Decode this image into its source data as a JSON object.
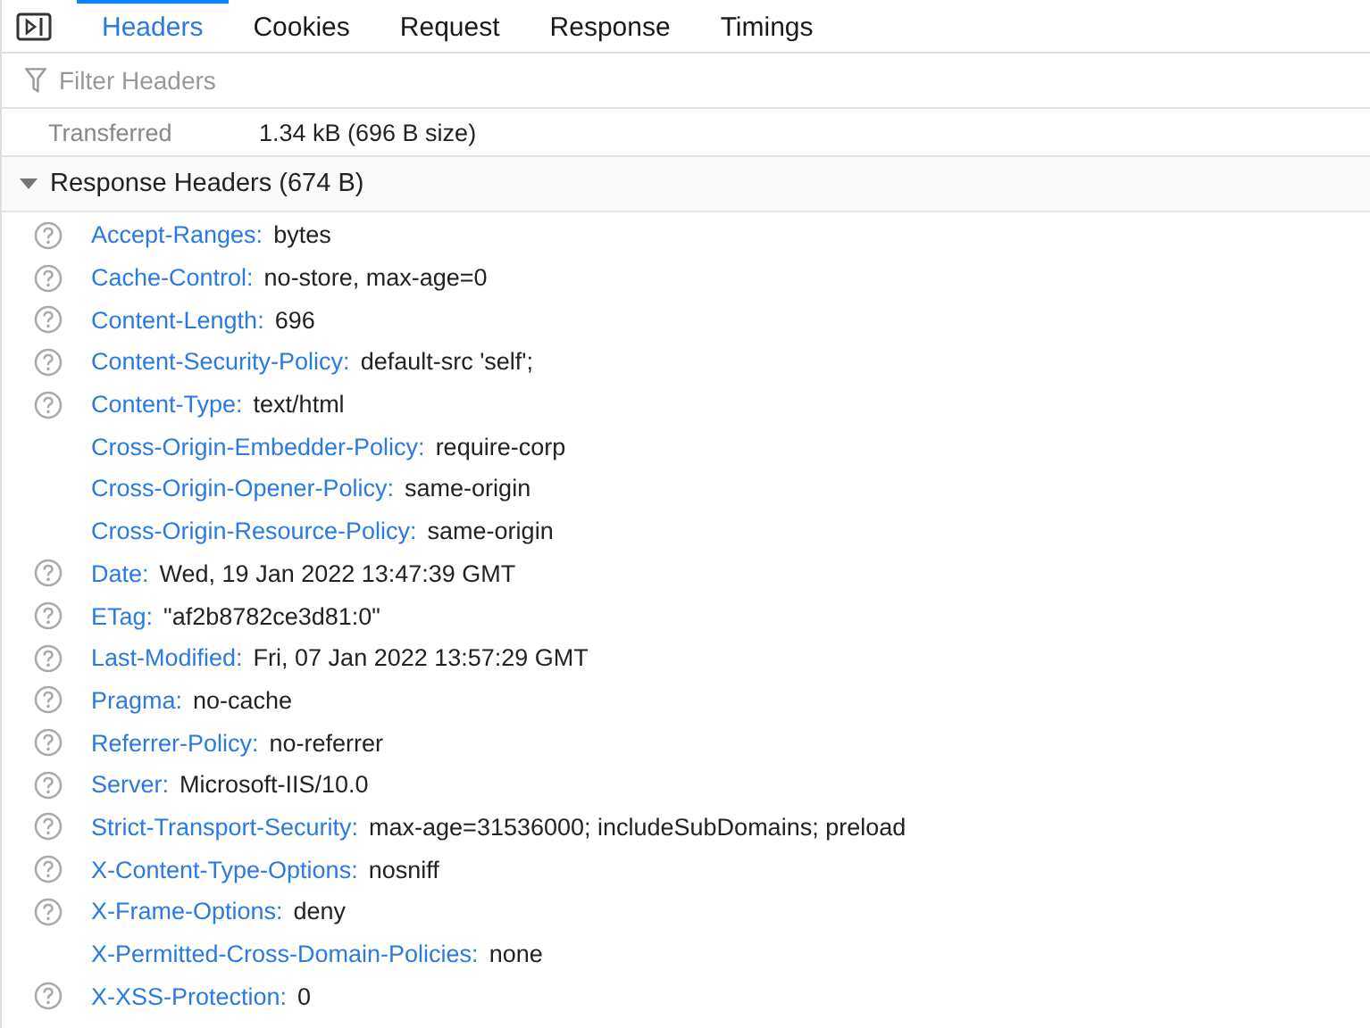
{
  "tabs": [
    {
      "label": "Headers",
      "selected": true
    },
    {
      "label": "Cookies",
      "selected": false
    },
    {
      "label": "Request",
      "selected": false
    },
    {
      "label": "Response",
      "selected": false
    },
    {
      "label": "Timings",
      "selected": false
    }
  ],
  "filter": {
    "placeholder": "Filter Headers"
  },
  "summary": {
    "label": "Transferred",
    "value": "1.34 kB (696 B size)"
  },
  "section": {
    "title": "Response Headers (674 B)",
    "expanded": true,
    "headers": [
      {
        "name": "Accept-Ranges:",
        "value": "bytes",
        "help": true
      },
      {
        "name": "Cache-Control:",
        "value": "no-store, max-age=0",
        "help": true
      },
      {
        "name": "Content-Length:",
        "value": "696",
        "help": true
      },
      {
        "name": "Content-Security-Policy:",
        "value": "default-src 'self';",
        "help": true
      },
      {
        "name": "Content-Type:",
        "value": "text/html",
        "help": true
      },
      {
        "name": "Cross-Origin-Embedder-Policy:",
        "value": "require-corp",
        "help": false
      },
      {
        "name": "Cross-Origin-Opener-Policy:",
        "value": "same-origin",
        "help": false
      },
      {
        "name": "Cross-Origin-Resource-Policy:",
        "value": "same-origin",
        "help": false
      },
      {
        "name": "Date:",
        "value": "Wed, 19 Jan 2022 13:47:39 GMT",
        "help": true
      },
      {
        "name": "ETag:",
        "value": "\"af2b8782ce3d81:0\"",
        "help": true
      },
      {
        "name": "Last-Modified:",
        "value": "Fri, 07 Jan 2022 13:57:29 GMT",
        "help": true
      },
      {
        "name": "Pragma:",
        "value": "no-cache",
        "help": true
      },
      {
        "name": "Referrer-Policy:",
        "value": "no-referrer",
        "help": true
      },
      {
        "name": "Server:",
        "value": "Microsoft-IIS/10.0",
        "help": true
      },
      {
        "name": "Strict-Transport-Security:",
        "value": "max-age=31536000; includeSubDomains; preload",
        "help": true
      },
      {
        "name": "X-Content-Type-Options:",
        "value": "nosniff",
        "help": true
      },
      {
        "name": "X-Frame-Options:",
        "value": "deny",
        "help": true
      },
      {
        "name": "X-Permitted-Cross-Domain-Policies:",
        "value": "none",
        "help": false
      },
      {
        "name": "X-XSS-Protection:",
        "value": "0",
        "help": true
      }
    ]
  }
}
